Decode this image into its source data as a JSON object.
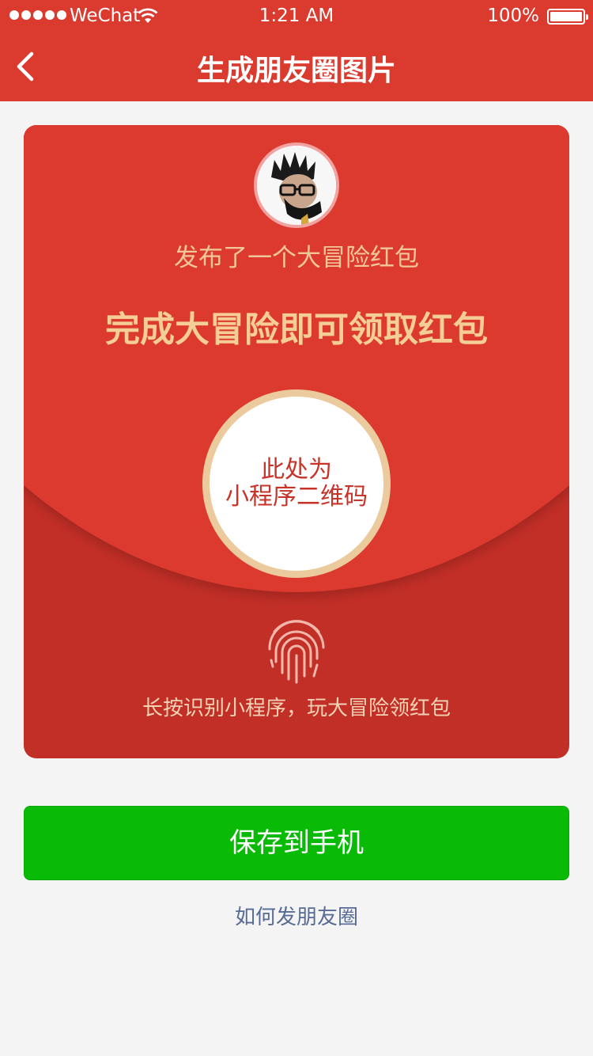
{
  "status_bar": {
    "carrier": "WeChat",
    "time": "1:21 AM",
    "battery": "100%"
  },
  "nav": {
    "title": "生成朋友圈图片",
    "back_icon": "chevron-left-icon"
  },
  "card": {
    "avatar_icon": "user-avatar",
    "publish_text": "发布了一个大冒险红包",
    "headline": "完成大冒险即可领取红包",
    "qr_line1": "此处为",
    "qr_line2": "小程序二维码",
    "fingerprint_icon": "fingerprint-icon",
    "hint": "长按识别小程序，玩大冒险领红包"
  },
  "actions": {
    "save_label": "保存到手机",
    "howto_label": "如何发朋友圈"
  },
  "colors": {
    "nav_red": "#db3a2f",
    "card_red_top": "#dc3a2f",
    "card_red_bottom": "#c22f27",
    "gold_text": "#f5cd97",
    "save_green": "#09bb07",
    "link_blue": "#576b95"
  }
}
